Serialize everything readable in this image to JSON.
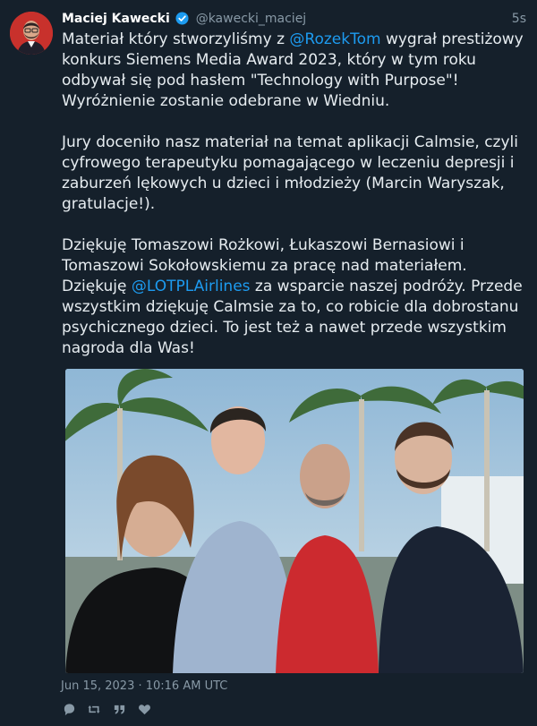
{
  "tweet": {
    "author_name": "Maciej Kawecki",
    "handle": "@kawecki_maciej",
    "time": "5s",
    "p1_a": "Materiał który stworzyliśmy z ",
    "p1_mention": "@RozekTom",
    "p1_b": " wygrał prestiżowy konkurs Siemens Media Award 2023, który w tym roku odbywał się pod hasłem \"Technology with Purpose\"! Wyróżnienie zostanie odebrane w Wiedniu.",
    "p2": "Jury doceniło nasz materiał na temat aplikacji Calmsie, czyli cyfrowego terapeutyku pomagającego w leczeniu depresji i zaburzeń lękowych u dzieci i młodzieży (Marcin Waryszak, gratulacje!).",
    "p3_a": "Dziękuję Tomaszowi Rożkowi, Łukaszowi Bernasiowi i Tomaszowi Sokołowskiemu za pracę nad materiałem. Dziękuję ",
    "p3_mention": "@LOTPLAirlines",
    "p3_b": " za wsparcie naszej podróży. Przede wszystkim dziękuję Calmsie za to, co robicie dla dobrostanu psychicznego dzieci. To jest też a nawet przede wszystkim nagroda dla Was!",
    "date": "Jun 15, 2023 · 10:16 AM UTC"
  },
  "icons": {
    "verified": "verified-badge-icon",
    "reply": "reply-icon",
    "retweet": "retweet-icon",
    "quote": "quote-icon",
    "like": "like-icon"
  },
  "colors": {
    "background": "#15202b",
    "text": "#e6ecf0",
    "muted": "#8899a6",
    "mention": "#1d9bf0",
    "verified": "#1d9bf0"
  }
}
